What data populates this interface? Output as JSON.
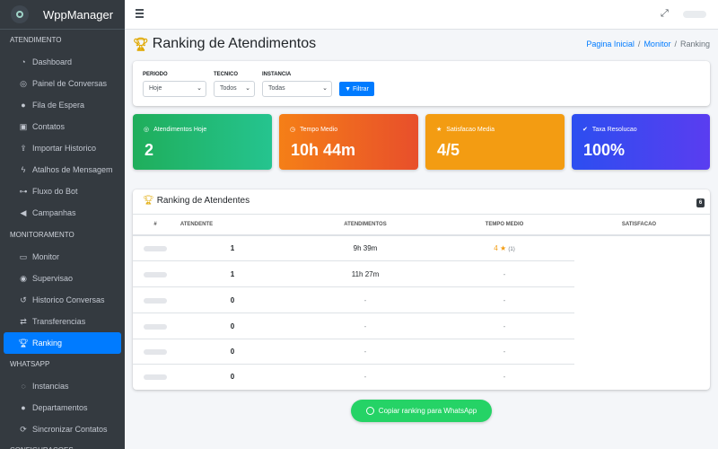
{
  "brand": {
    "name": "WppManager"
  },
  "sidebar": {
    "sections": [
      {
        "header": "ATENDIMENTO",
        "items": [
          {
            "label": "Dashboard",
            "icon": "gauge-icon"
          },
          {
            "label": "Painel de Conversas",
            "icon": "headset-icon"
          },
          {
            "label": "Fila de Espera",
            "icon": "users-icon"
          },
          {
            "label": "Contatos",
            "icon": "address-book-icon"
          },
          {
            "label": "Importar Historico",
            "icon": "upload-icon"
          },
          {
            "label": "Atalhos de Mensagem",
            "icon": "bolt-icon"
          },
          {
            "label": "Fluxo do Bot",
            "icon": "flow-icon"
          },
          {
            "label": "Campanhas",
            "icon": "megaphone-icon"
          }
        ]
      },
      {
        "header": "MONITORAMENTO",
        "items": [
          {
            "label": "Monitor",
            "icon": "desktop-icon"
          },
          {
            "label": "Supervisao",
            "icon": "eye-icon"
          },
          {
            "label": "Historico Conversas",
            "icon": "history-icon"
          },
          {
            "label": "Transferencias",
            "icon": "exchange-icon"
          },
          {
            "label": "Ranking",
            "icon": "trophy-icon",
            "active": true
          }
        ]
      },
      {
        "header": "WHATSAPP",
        "items": [
          {
            "label": "Instancias",
            "icon": "whatsapp-icon"
          },
          {
            "label": "Departamentos",
            "icon": "users-icon"
          },
          {
            "label": "Sincronizar Contatos",
            "icon": "sync-icon"
          }
        ]
      },
      {
        "header": "CONFIGURACOES",
        "items": []
      }
    ]
  },
  "header": {
    "title": "Ranking de Atendimentos",
    "breadcrumb": [
      "Pagina Inicial",
      "Monitor",
      "Ranking"
    ]
  },
  "filters": {
    "periodo_label": "PERIODO",
    "periodo_value": "Hoje",
    "tecnico_label": "TECNICO",
    "tecnico_value": "Todos",
    "instancia_label": "INSTANCIA",
    "instancia_value": "Todas",
    "button_label": "Filtrar"
  },
  "stats": [
    {
      "label": "Atendimentos Hoje",
      "value": "2",
      "icon": "headset-icon"
    },
    {
      "label": "Tempo Medio",
      "value": "10h 44m",
      "icon": "clock-icon"
    },
    {
      "label": "Satisfacao Media",
      "value": "4/5",
      "icon": "star-icon"
    },
    {
      "label": "Taxa Resolucao",
      "value": "100%",
      "icon": "check-circle-icon"
    }
  ],
  "ranking": {
    "title": "Ranking de Atendentes",
    "badge": "6",
    "columns": [
      "#",
      "ATENDENTE",
      "ATENDIMENTOS",
      "TEMPO MEDIO",
      "SATISFACAO"
    ],
    "rows": [
      {
        "atendimentos": "1",
        "tempo": "9h 39m",
        "satisfacao": "4",
        "satisfacao_count": "(1)"
      },
      {
        "atendimentos": "1",
        "tempo": "11h 27m",
        "satisfacao": "-"
      },
      {
        "atendimentos": "0",
        "tempo": "-",
        "satisfacao": "-"
      },
      {
        "atendimentos": "0",
        "tempo": "-",
        "satisfacao": "-"
      },
      {
        "atendimentos": "0",
        "tempo": "-",
        "satisfacao": "-"
      },
      {
        "atendimentos": "0",
        "tempo": "-",
        "satisfacao": "-"
      }
    ]
  },
  "whatsapp_button": {
    "label": "Copiar ranking para WhatsApp"
  },
  "colors": {
    "primary": "#007bff",
    "sidebar": "#343a40",
    "green": "#25d366",
    "warning": "#f39c12"
  }
}
